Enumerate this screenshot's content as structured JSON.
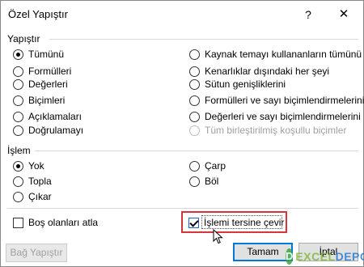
{
  "window": {
    "title": "Özel Yapıştır",
    "help_label": "?",
    "close_label": "✕"
  },
  "paste_group": {
    "label": "Yapıştır",
    "left_options": [
      {
        "label": "Tümünü",
        "checked": true
      },
      {
        "label": "Formülleri",
        "checked": false
      },
      {
        "label": "Değerleri",
        "checked": false
      },
      {
        "label": "Biçimleri",
        "checked": false
      },
      {
        "label": "Açıklamaları",
        "checked": false
      },
      {
        "label": "Doğrulamayı",
        "checked": false
      }
    ],
    "right_options": [
      {
        "label": "Kaynak temayı kullananların tümünü",
        "checked": false,
        "disabled": false
      },
      {
        "label": "Kenarlıklar dışındaki her şeyi",
        "checked": false,
        "disabled": false
      },
      {
        "label": "Sütun genişliklerini",
        "checked": false,
        "disabled": false
      },
      {
        "label": "Formülleri ve sayı biçimlendirmelerini",
        "checked": false,
        "disabled": false
      },
      {
        "label": "Değerleri ve sayı biçimlendirmelerini",
        "checked": false,
        "disabled": false
      },
      {
        "label": "Tüm birleştirilmiş koşullu biçimler",
        "checked": false,
        "disabled": true
      }
    ]
  },
  "operation_group": {
    "label": "İşlem",
    "left_options": [
      {
        "label": "Yok",
        "checked": true
      },
      {
        "label": "Topla",
        "checked": false
      },
      {
        "label": "Çıkar",
        "checked": false
      }
    ],
    "right_options": [
      {
        "label": "Çarp",
        "checked": false
      },
      {
        "label": "Böl",
        "checked": false
      }
    ]
  },
  "checkboxes": {
    "skip_blanks": {
      "label": "Boş olanları atla",
      "checked": false
    },
    "transpose": {
      "label": "İşlemi tersine çevir",
      "checked": true
    }
  },
  "buttons": {
    "paste_link": "Bağ Yapıştır",
    "ok": "Tamam",
    "cancel": "İptal"
  },
  "colors": {
    "highlight": "#d9343a",
    "default_button_border": "#0078d7"
  },
  "watermark": {
    "logo_letter": "D",
    "text_prefix": "EXCEL",
    "text_suffix": "DEPO"
  }
}
